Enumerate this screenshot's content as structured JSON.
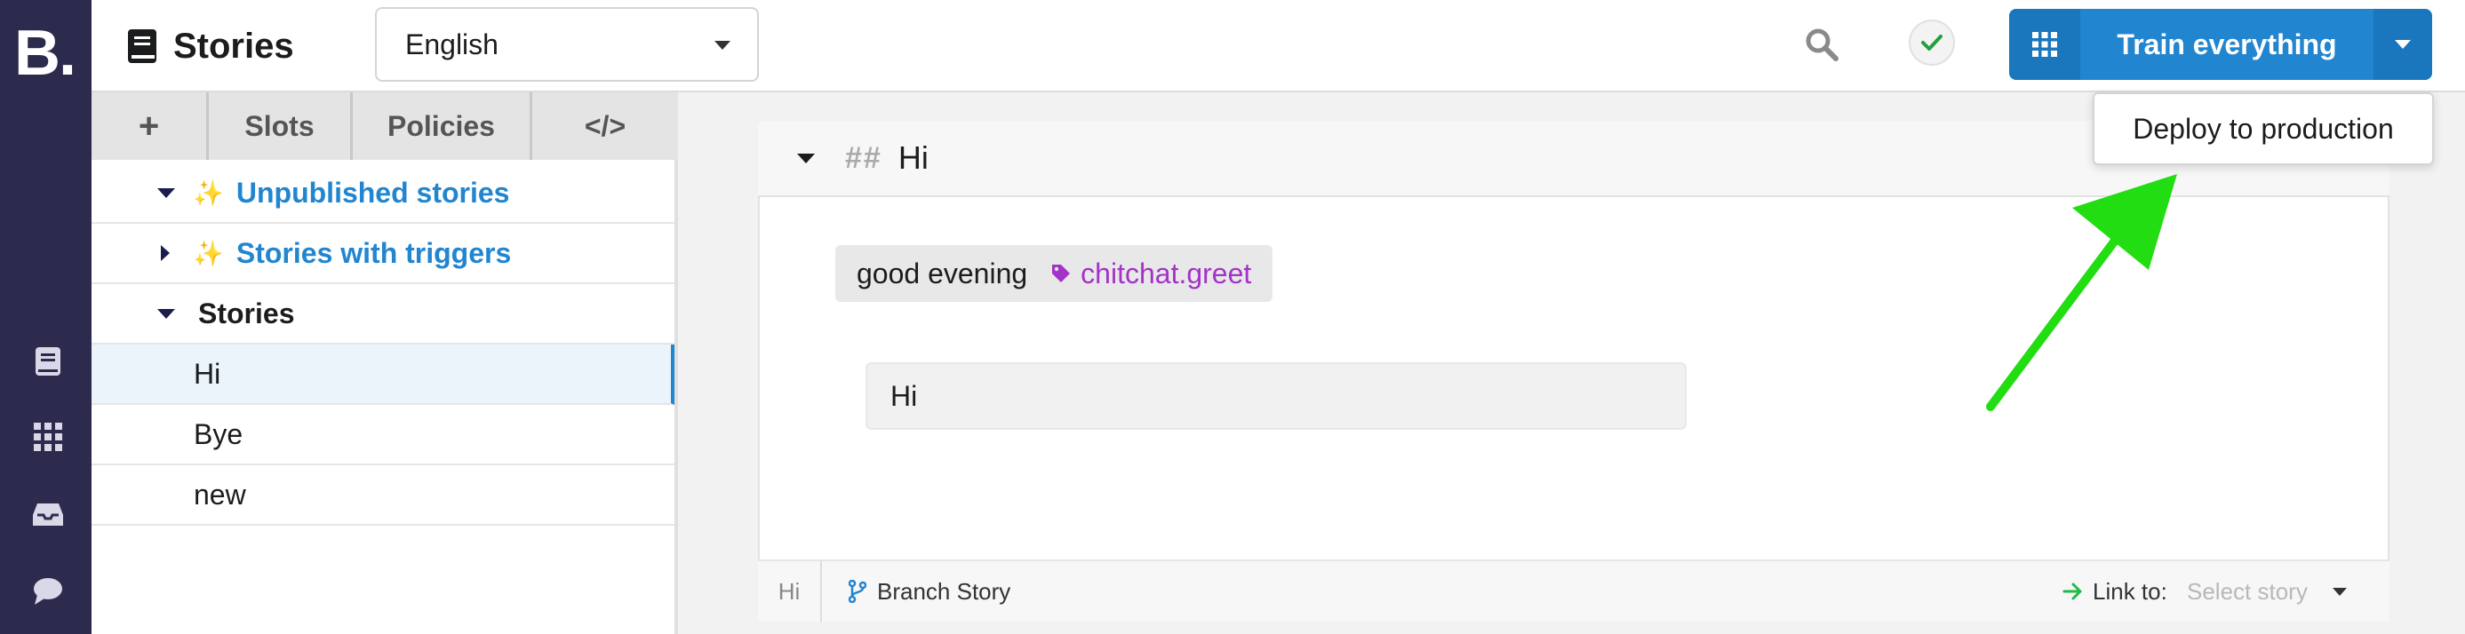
{
  "app": {
    "logo_text": "B."
  },
  "rail": {
    "icons": [
      "book-icon",
      "grid-icon",
      "inbox-icon",
      "chat-icon"
    ]
  },
  "header": {
    "title": "Stories",
    "language": "English",
    "train_label": "Train everything",
    "deploy_label": "Deploy to production"
  },
  "tabs": {
    "add": "+",
    "slots": "Slots",
    "policies": "Policies",
    "code": "</>"
  },
  "tree": {
    "unpublished": "Unpublished stories",
    "triggers": "Stories with triggers",
    "stories": "Stories",
    "items": [
      "Hi",
      "Bye",
      "new"
    ],
    "sparkle": "✨"
  },
  "story": {
    "hash": "##",
    "title": "Hi",
    "user_text": "good evening",
    "intent": "chitchat.greet",
    "bot_response": "Hi",
    "footer_name": "Hi",
    "branch_label": "Branch Story",
    "link_to_label": "Link to:",
    "link_placeholder": "Select story"
  },
  "colors": {
    "accent": "#2185d0",
    "rail": "#2c2b4d",
    "intent": "#a333c8",
    "arrow": "#22dd11"
  }
}
